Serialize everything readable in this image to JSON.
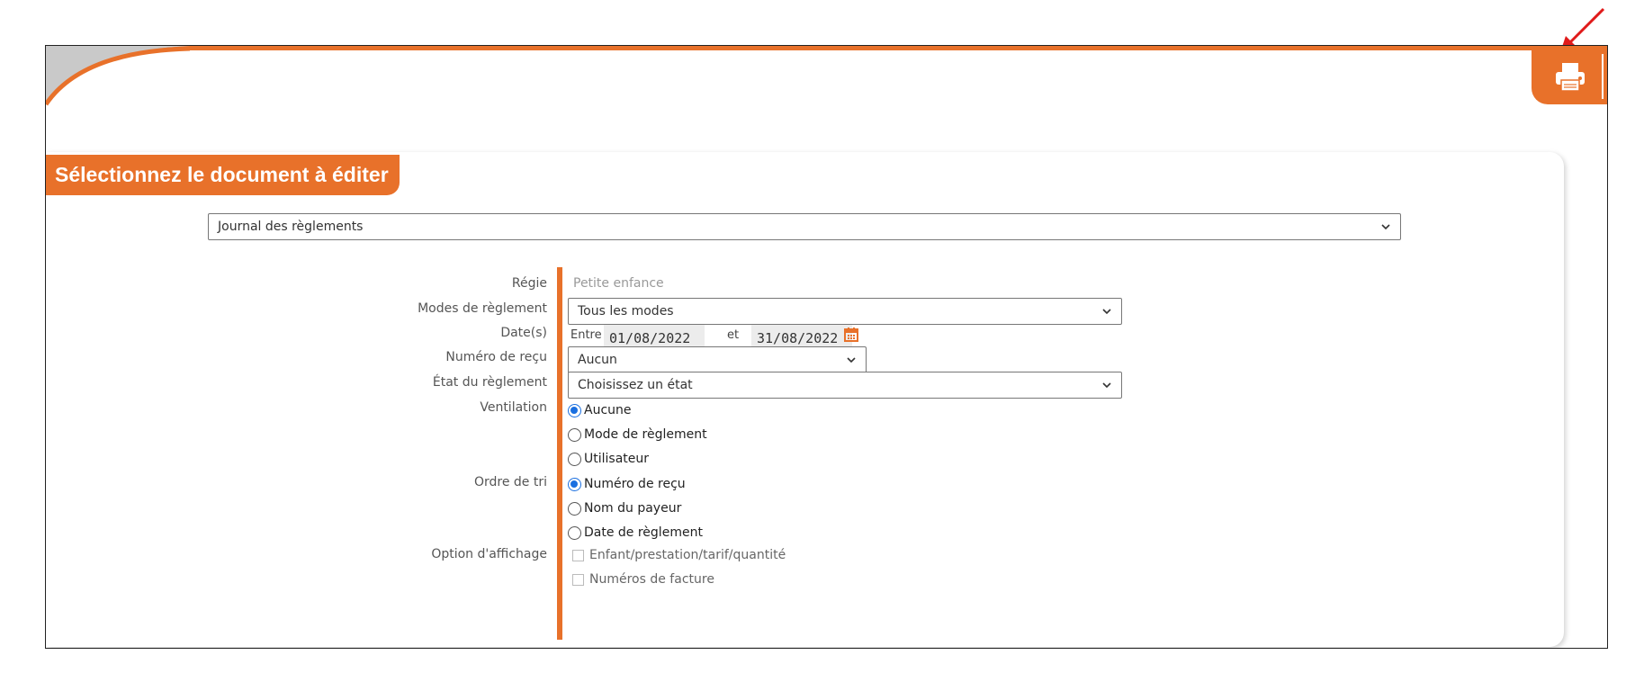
{
  "colors": {
    "accent": "#e8712a",
    "radio_selected": "#1a6fe0",
    "arrow": "#e01a1a"
  },
  "toolbar": {
    "print_icon": "printer-icon"
  },
  "panel": {
    "title": "Sélectionnez le document à éditer"
  },
  "document_select": {
    "value": "Journal des règlements"
  },
  "form": {
    "regie": {
      "label": "Régie",
      "value": "Petite enfance"
    },
    "modes": {
      "label": "Modes de règlement",
      "value": "Tous les modes"
    },
    "dates": {
      "label": "Date(s)",
      "entre": "Entre",
      "from": "01/08/2022",
      "et": "et",
      "to": "31/08/2022",
      "icon": "calendar-icon"
    },
    "recu": {
      "label": "Numéro de reçu",
      "value": "Aucun"
    },
    "etat": {
      "label": "État du règlement",
      "value": "Choisissez un état"
    },
    "ventilation": {
      "label": "Ventilation",
      "options": [
        {
          "label": "Aucune",
          "selected": true
        },
        {
          "label": "Mode de règlement",
          "selected": false
        },
        {
          "label": "Utilisateur",
          "selected": false
        }
      ]
    },
    "tri": {
      "label": "Ordre de tri",
      "options": [
        {
          "label": "Numéro de reçu",
          "selected": true
        },
        {
          "label": "Nom du payeur",
          "selected": false
        },
        {
          "label": "Date de règlement",
          "selected": false
        }
      ]
    },
    "affichage": {
      "label": "Option d'affichage",
      "options": [
        {
          "label": "Enfant/prestation/tarif/quantité",
          "checked": false
        },
        {
          "label": "Numéros de facture",
          "checked": false
        }
      ]
    }
  }
}
